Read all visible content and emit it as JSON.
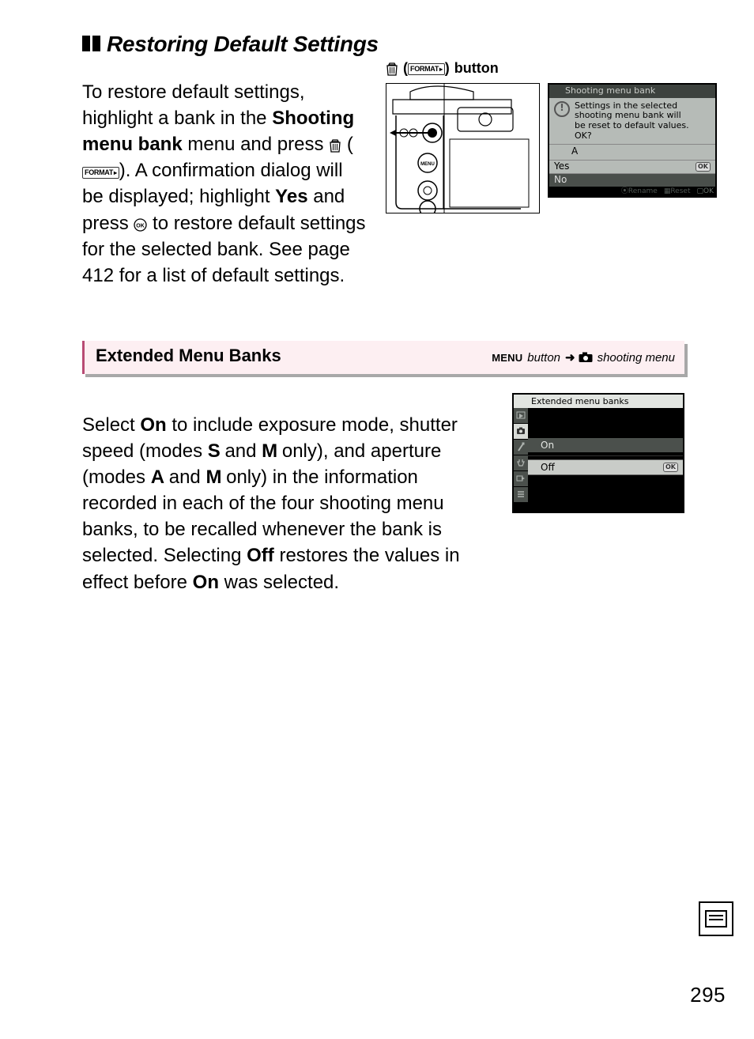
{
  "section1": {
    "heading": "Restoring Default Settings",
    "text_parts": {
      "t1": "To restore default settings, highlight a bank in the ",
      "b1": "Shooting menu bank",
      "t2": " menu and press ",
      "t3": ".  A confirmation dialog will be displayed; highlight ",
      "b2": "Yes",
      "t4": " and press ",
      "t5": " to restore default settings for the selected bank. See page 412 for a list of default settings."
    },
    "button_caption_suffix": "button",
    "format_label": "FORMAT",
    "lcd": {
      "title": "Shooting menu bank",
      "msg_line1": "Settings in the selected",
      "msg_line2": "shooting menu bank will",
      "msg_line3": "be reset to default values.",
      "msg_line4": "OK?",
      "bank": "A",
      "yes": "Yes",
      "no": "No",
      "ok": "OK",
      "footer_rename": "Rename",
      "footer_reset": "Reset",
      "footer_ok": "OK"
    }
  },
  "pinkbar": {
    "title": "Extended Menu Banks",
    "menu_label": "MENU",
    "button_word": "button",
    "arrow": "➜",
    "dest": "shooting menu"
  },
  "section2": {
    "text_parts": {
      "t1": "Select ",
      "b1": "On",
      "t2": " to include exposure mode, shutter speed (modes ",
      "m1": "S",
      "t3": " and ",
      "m2": "M",
      "t4": " only), and aperture (modes ",
      "m3": "A",
      "t5": " and ",
      "m4": "M",
      "t6": " only) in the information recorded in each of the four shooting menu banks, to be recalled whenever the bank is selected. Selecting ",
      "b2": "Off",
      "t7": " restores the values in effect before ",
      "b3": "On",
      "t8": " was selected."
    },
    "lcd": {
      "title": "Extended menu banks",
      "on": "On",
      "off": "Off",
      "ok": "OK"
    }
  },
  "page_number": "295"
}
